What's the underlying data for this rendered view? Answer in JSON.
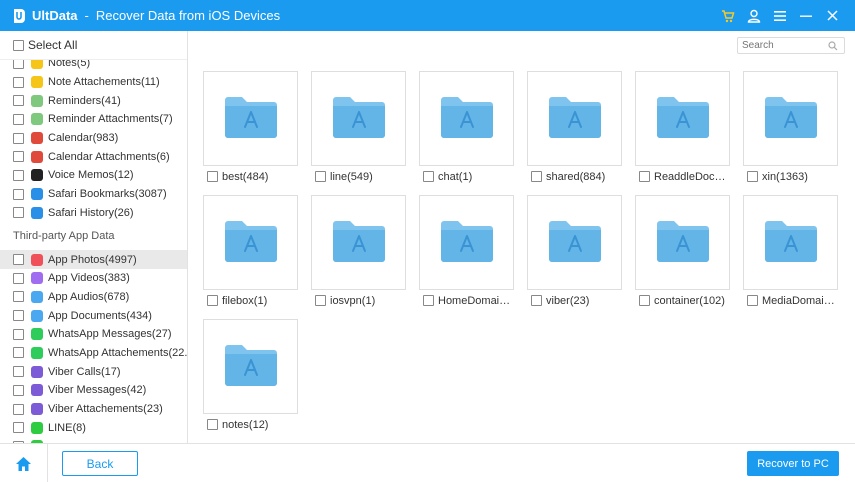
{
  "titlebar": {
    "app_name": "UltData",
    "separator": "-",
    "subtitle": "Recover Data from iOS Devices",
    "accent": "#1a9bf0",
    "icons": [
      "cart-icon",
      "user-icon",
      "menu-icon",
      "minimize-icon",
      "close-icon"
    ]
  },
  "sidebar": {
    "select_all": "Select All",
    "items_top": [
      {
        "label": "Notes(5)",
        "icon": "notes-icon",
        "color": "#f5c518"
      },
      {
        "label": "Note Attachements(11)",
        "icon": "note-attachments-icon",
        "color": "#f5c518"
      },
      {
        "label": "Reminders(41)",
        "icon": "reminders-icon",
        "color": "#7fc97f"
      },
      {
        "label": "Reminder Attachments(7)",
        "icon": "reminder-attachments-icon",
        "color": "#7fc97f"
      },
      {
        "label": "Calendar(983)",
        "icon": "calendar-icon",
        "color": "#e04a3a"
      },
      {
        "label": "Calendar Attachments(6)",
        "icon": "calendar-attachments-icon",
        "color": "#e04a3a"
      },
      {
        "label": "Voice Memos(12)",
        "icon": "voice-memos-icon",
        "color": "#222222"
      },
      {
        "label": "Safari Bookmarks(3087)",
        "icon": "safari-icon",
        "color": "#2a8fe6"
      },
      {
        "label": "Safari History(26)",
        "icon": "safari-icon",
        "color": "#2a8fe6"
      }
    ],
    "section_label": "Third-party App Data",
    "items_third": [
      {
        "label": "App Photos(4997)",
        "icon": "app-photos-icon",
        "color": "#f0505a",
        "selected": true
      },
      {
        "label": "App Videos(383)",
        "icon": "app-videos-icon",
        "color": "#a06cf0"
      },
      {
        "label": "App Audios(678)",
        "icon": "app-audios-icon",
        "color": "#4aa8f0"
      },
      {
        "label": "App Documents(434)",
        "icon": "app-documents-icon",
        "color": "#4aa8f0"
      },
      {
        "label": "WhatsApp Messages(27)",
        "icon": "whatsapp-icon",
        "color": "#2ecc5a"
      },
      {
        "label": "WhatsApp Attachements(22...",
        "icon": "whatsapp-icon",
        "color": "#2ecc5a"
      },
      {
        "label": "Viber Calls(17)",
        "icon": "viber-icon",
        "color": "#7d5bd6"
      },
      {
        "label": "Viber Messages(42)",
        "icon": "viber-icon",
        "color": "#7d5bd6"
      },
      {
        "label": "Viber Attachements(23)",
        "icon": "viber-icon",
        "color": "#7d5bd6"
      },
      {
        "label": "LINE(8)",
        "icon": "line-icon",
        "color": "#2ecc40"
      },
      {
        "label": "",
        "icon": "line-icon",
        "color": "#2ecc40"
      }
    ]
  },
  "search": {
    "placeholder": "Search"
  },
  "folders": [
    {
      "label": "best(484)"
    },
    {
      "label": "line(549)"
    },
    {
      "label": "chat(1)"
    },
    {
      "label": "shared(884)"
    },
    {
      "label": "ReaddleDocsIP..."
    },
    {
      "label": "xin(1363)"
    },
    {
      "label": "filebox(1)"
    },
    {
      "label": "iosvpn(1)"
    },
    {
      "label": "HomeDomain(..."
    },
    {
      "label": "viber(23)"
    },
    {
      "label": "container(102)"
    },
    {
      "label": "MediaDomain(..."
    },
    {
      "label": "notes(12)"
    }
  ],
  "footer": {
    "back_label": "Back",
    "recover_label": "Recover to PC"
  }
}
